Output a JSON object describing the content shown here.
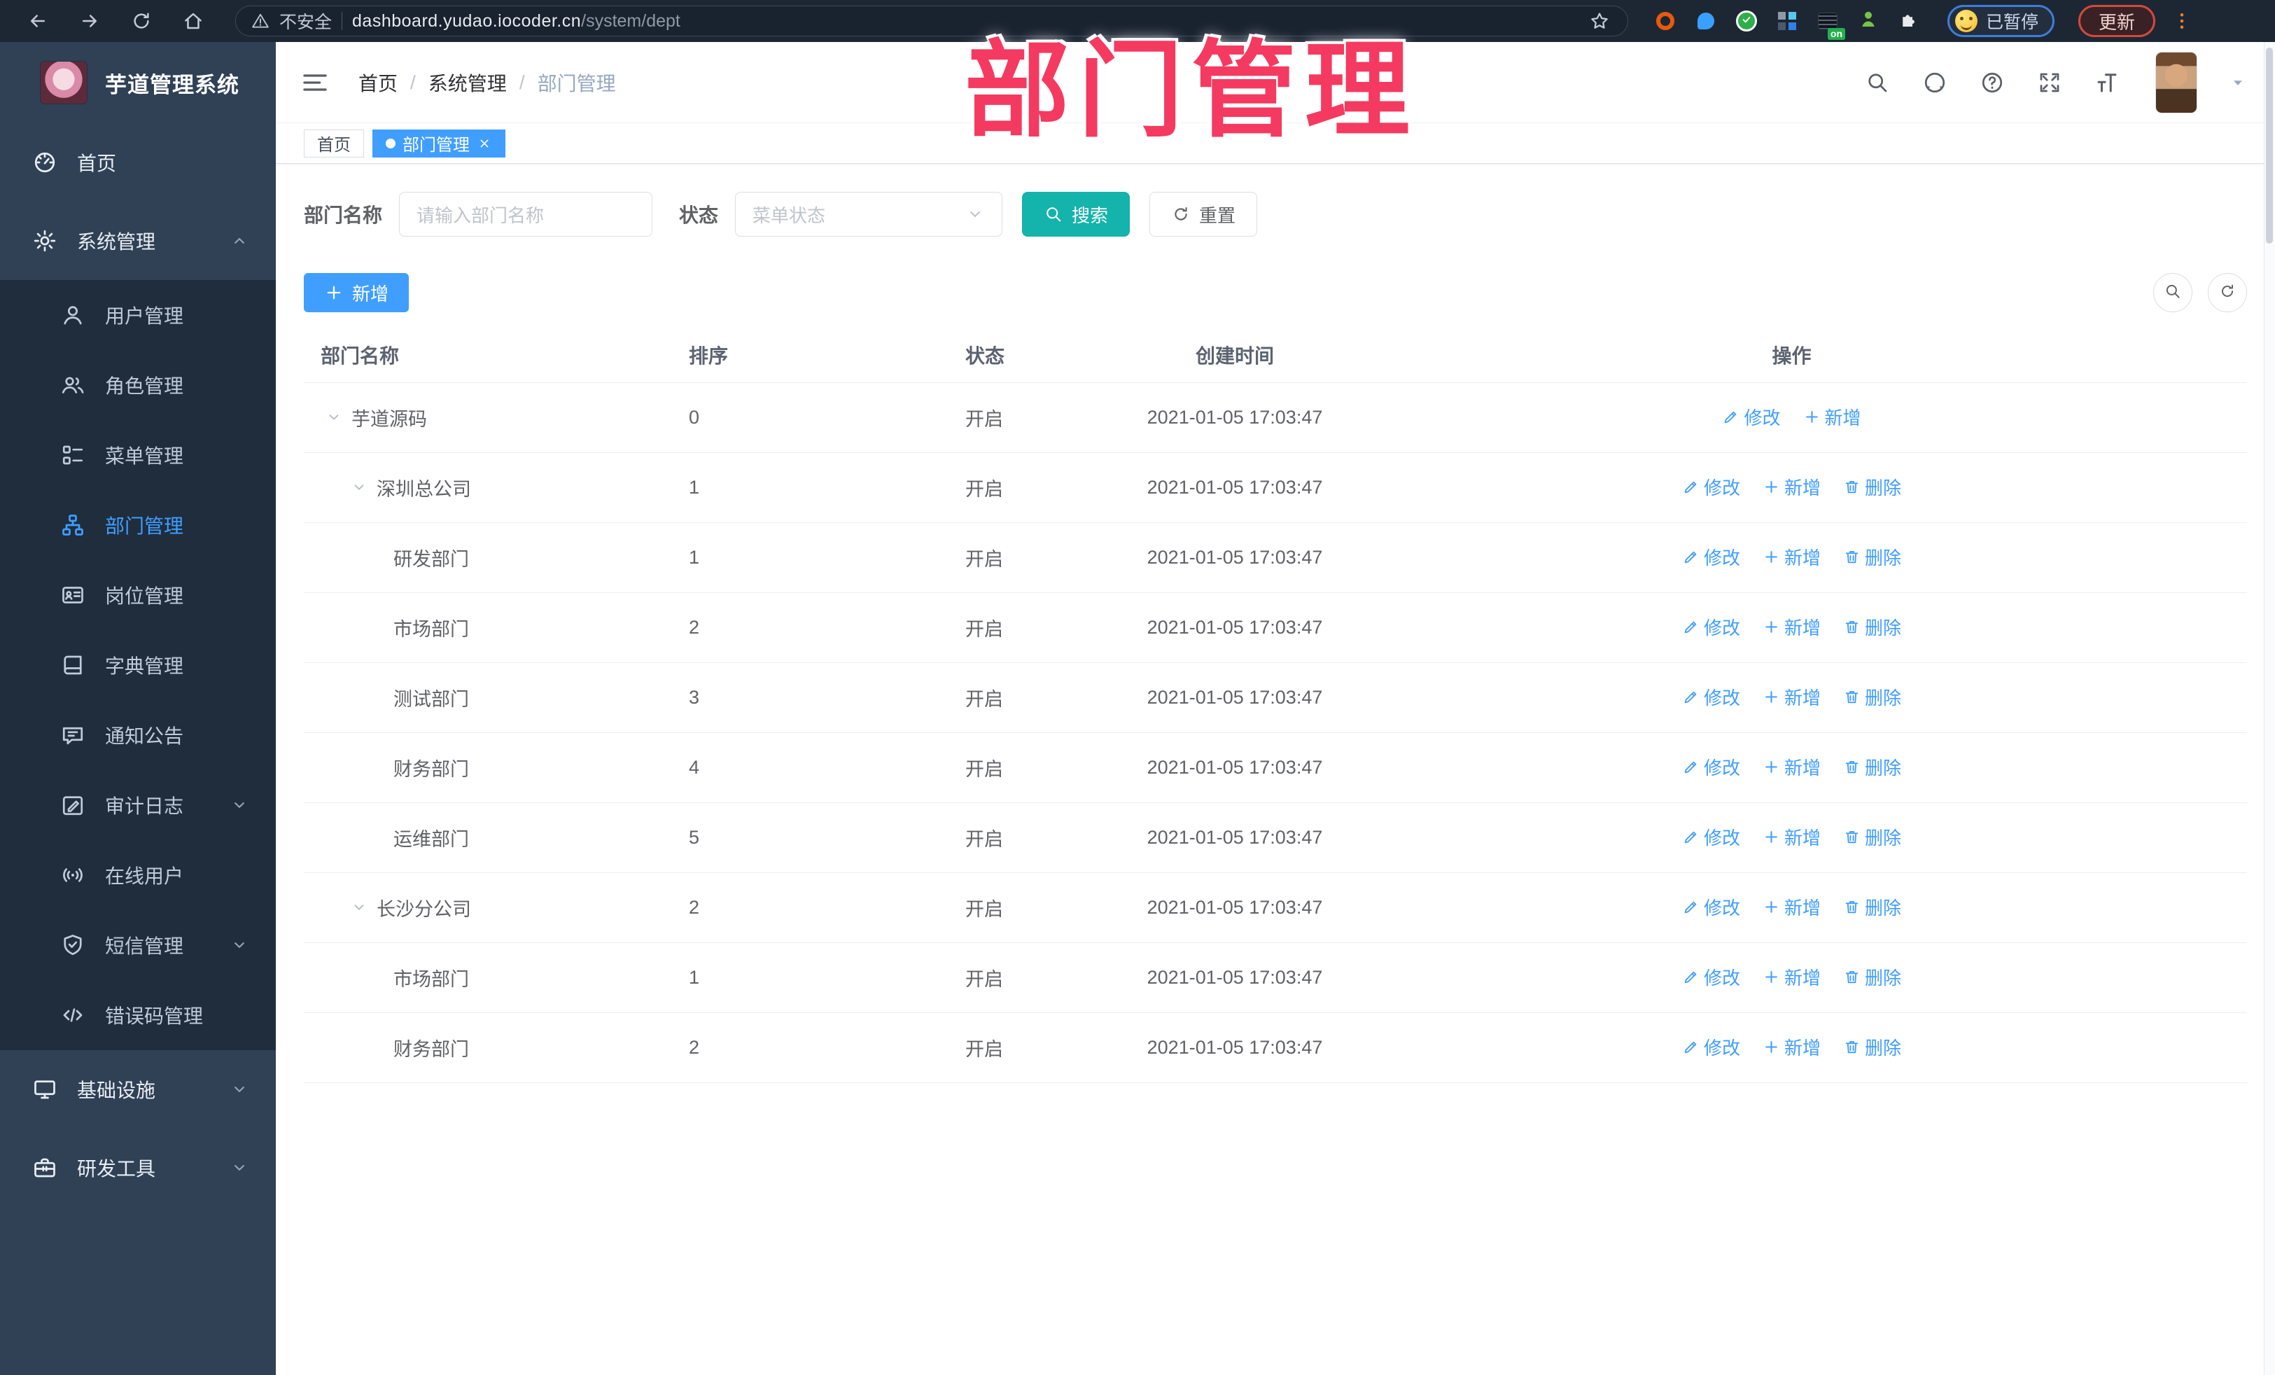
{
  "watermark": "部门管理",
  "colors": {
    "accent_blue": "#409eff",
    "search_teal": "#14b3ab",
    "watermark_pink": "#f43a60",
    "sidebar_bg": "#304156",
    "submenu_bg": "#1f2d3d",
    "tag_active_bg": "#409eff"
  },
  "browser": {
    "security_label": "不安全",
    "url_host": "dashboard.yudao.iocoder.cn",
    "url_path": "/system/dept",
    "extension_on_badge": "on",
    "paused_badge": "已暂停",
    "update_button": "更新"
  },
  "sidebar": {
    "title": "芋道管理系统",
    "items": [
      {
        "key": "home",
        "label": "首页",
        "icon": "dashboard-icon",
        "type": "top"
      },
      {
        "key": "system",
        "label": "系统管理",
        "icon": "gear-icon",
        "type": "top",
        "caret": "up"
      },
      {
        "key": "user",
        "label": "用户管理",
        "icon": "user-icon",
        "type": "sub"
      },
      {
        "key": "role",
        "label": "角色管理",
        "icon": "users-icon",
        "type": "sub"
      },
      {
        "key": "menu",
        "label": "菜单管理",
        "icon": "menu-tree-icon",
        "type": "sub"
      },
      {
        "key": "dept",
        "label": "部门管理",
        "icon": "org-tree-icon",
        "type": "sub",
        "active": true
      },
      {
        "key": "post",
        "label": "岗位管理",
        "icon": "id-card-icon",
        "type": "sub"
      },
      {
        "key": "dict",
        "label": "字典管理",
        "icon": "book-icon",
        "type": "sub"
      },
      {
        "key": "notice",
        "label": "通知公告",
        "icon": "announcement-icon",
        "type": "sub"
      },
      {
        "key": "audit-log",
        "label": "审计日志",
        "icon": "edit-log-icon",
        "type": "sub",
        "caret": "down"
      },
      {
        "key": "online-user",
        "label": "在线用户",
        "icon": "online-icon",
        "type": "sub"
      },
      {
        "key": "sms",
        "label": "短信管理",
        "icon": "sms-icon",
        "type": "sub",
        "caret": "down"
      },
      {
        "key": "error-code",
        "label": "错误码管理",
        "icon": "code-icon",
        "type": "sub"
      },
      {
        "key": "infra",
        "label": "基础设施",
        "icon": "monitor-icon",
        "type": "top",
        "caret": "down"
      },
      {
        "key": "dev-tools",
        "label": "研发工具",
        "icon": "toolbox-icon",
        "type": "top",
        "caret": "down"
      }
    ]
  },
  "header": {
    "breadcrumb": [
      "首页",
      "系统管理",
      "部门管理"
    ]
  },
  "tags": [
    {
      "key": "home",
      "label": "首页",
      "active": false,
      "closable": false
    },
    {
      "key": "dept",
      "label": "部门管理",
      "active": true,
      "closable": true
    }
  ],
  "filters": {
    "name_label": "部门名称",
    "name_placeholder": "请输入部门名称",
    "status_label": "状态",
    "status_placeholder": "菜单状态",
    "search_label": "搜索",
    "reset_label": "重置"
  },
  "toolbar": {
    "add_label": "新增"
  },
  "table": {
    "columns": [
      "部门名称",
      "排序",
      "状态",
      "创建时间",
      "操作"
    ],
    "rows": [
      {
        "name": "芋道源码",
        "level": 1,
        "expandable": true,
        "sort": "0",
        "status": "开启",
        "created": "2021-01-05 17:03:47",
        "actions": [
          {
            "name": "edit",
            "label": "修改",
            "icon": "edit-pen-icon"
          },
          {
            "name": "add",
            "label": "新增",
            "icon": "plus-icon"
          }
        ]
      },
      {
        "name": "深圳总公司",
        "level": 2,
        "expandable": true,
        "sort": "1",
        "status": "开启",
        "created": "2021-01-05 17:03:47",
        "actions": [
          {
            "name": "edit",
            "label": "修改",
            "icon": "edit-pen-icon"
          },
          {
            "name": "add",
            "label": "新增",
            "icon": "plus-icon"
          },
          {
            "name": "delete",
            "label": "删除",
            "icon": "trash-icon"
          }
        ]
      },
      {
        "name": "研发部门",
        "level": 3,
        "expandable": false,
        "sort": "1",
        "status": "开启",
        "created": "2021-01-05 17:03:47",
        "actions": [
          {
            "name": "edit",
            "label": "修改",
            "icon": "edit-pen-icon"
          },
          {
            "name": "add",
            "label": "新增",
            "icon": "plus-icon"
          },
          {
            "name": "delete",
            "label": "删除",
            "icon": "trash-icon"
          }
        ]
      },
      {
        "name": "市场部门",
        "level": 3,
        "expandable": false,
        "sort": "2",
        "status": "开启",
        "created": "2021-01-05 17:03:47",
        "actions": [
          {
            "name": "edit",
            "label": "修改",
            "icon": "edit-pen-icon"
          },
          {
            "name": "add",
            "label": "新增",
            "icon": "plus-icon"
          },
          {
            "name": "delete",
            "label": "删除",
            "icon": "trash-icon"
          }
        ]
      },
      {
        "name": "测试部门",
        "level": 3,
        "expandable": false,
        "sort": "3",
        "status": "开启",
        "created": "2021-01-05 17:03:47",
        "actions": [
          {
            "name": "edit",
            "label": "修改",
            "icon": "edit-pen-icon"
          },
          {
            "name": "add",
            "label": "新增",
            "icon": "plus-icon"
          },
          {
            "name": "delete",
            "label": "删除",
            "icon": "trash-icon"
          }
        ]
      },
      {
        "name": "财务部门",
        "level": 3,
        "expandable": false,
        "sort": "4",
        "status": "开启",
        "created": "2021-01-05 17:03:47",
        "actions": [
          {
            "name": "edit",
            "label": "修改",
            "icon": "edit-pen-icon"
          },
          {
            "name": "add",
            "label": "新增",
            "icon": "plus-icon"
          },
          {
            "name": "delete",
            "label": "删除",
            "icon": "trash-icon"
          }
        ]
      },
      {
        "name": "运维部门",
        "level": 3,
        "expandable": false,
        "sort": "5",
        "status": "开启",
        "created": "2021-01-05 17:03:47",
        "actions": [
          {
            "name": "edit",
            "label": "修改",
            "icon": "edit-pen-icon"
          },
          {
            "name": "add",
            "label": "新增",
            "icon": "plus-icon"
          },
          {
            "name": "delete",
            "label": "删除",
            "icon": "trash-icon"
          }
        ]
      },
      {
        "name": "长沙分公司",
        "level": 2,
        "expandable": true,
        "sort": "2",
        "status": "开启",
        "created": "2021-01-05 17:03:47",
        "actions": [
          {
            "name": "edit",
            "label": "修改",
            "icon": "edit-pen-icon"
          },
          {
            "name": "add",
            "label": "新增",
            "icon": "plus-icon"
          },
          {
            "name": "delete",
            "label": "删除",
            "icon": "trash-icon"
          }
        ]
      },
      {
        "name": "市场部门",
        "level": 3,
        "expandable": false,
        "sort": "1",
        "status": "开启",
        "created": "2021-01-05 17:03:47",
        "actions": [
          {
            "name": "edit",
            "label": "修改",
            "icon": "edit-pen-icon"
          },
          {
            "name": "add",
            "label": "新增",
            "icon": "plus-icon"
          },
          {
            "name": "delete",
            "label": "删除",
            "icon": "trash-icon"
          }
        ]
      },
      {
        "name": "财务部门",
        "level": 3,
        "expandable": false,
        "sort": "2",
        "status": "开启",
        "created": "2021-01-05 17:03:47",
        "actions": [
          {
            "name": "edit",
            "label": "修改",
            "icon": "edit-pen-icon"
          },
          {
            "name": "add",
            "label": "新增",
            "icon": "plus-icon"
          },
          {
            "name": "delete",
            "label": "删除",
            "icon": "trash-icon"
          }
        ]
      }
    ]
  }
}
